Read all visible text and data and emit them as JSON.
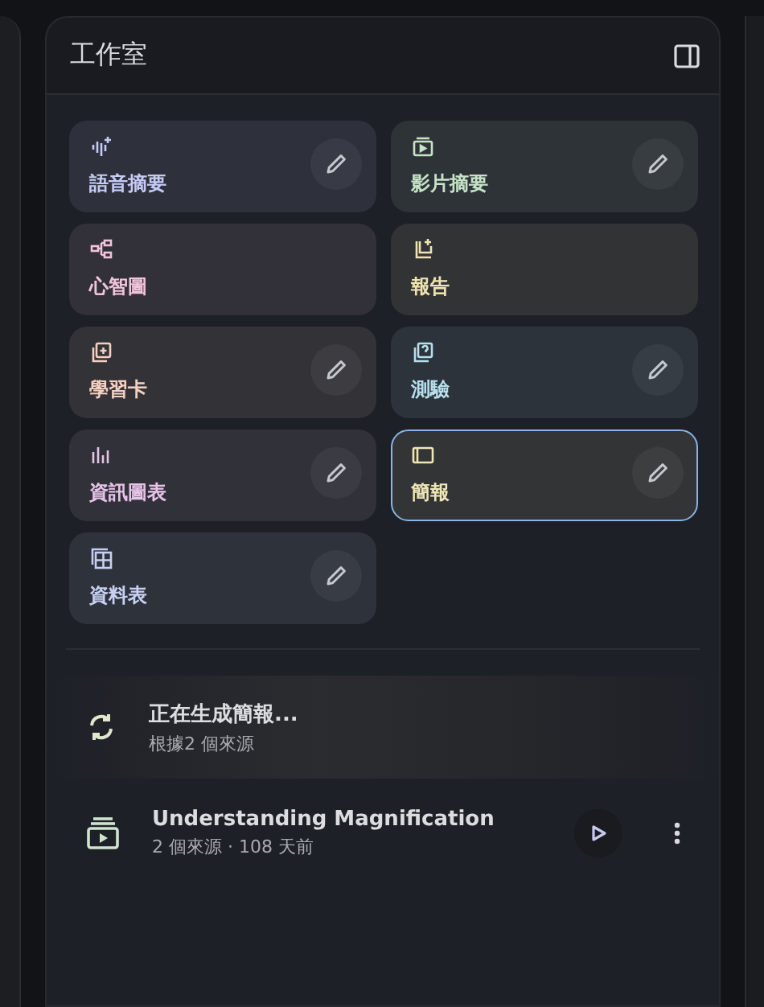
{
  "panel": {
    "title": "工作室"
  },
  "tiles": [
    {
      "label": "語音摘要",
      "kind": "audio",
      "color": "#c5cbf5",
      "editable": true,
      "selected": false
    },
    {
      "label": "影片摘要",
      "kind": "video",
      "color": "#c6e3c8",
      "editable": true,
      "selected": false
    },
    {
      "label": "心智圖",
      "kind": "mindmap",
      "color": "#f2c4dc",
      "editable": false,
      "selected": false
    },
    {
      "label": "報告",
      "kind": "report",
      "color": "#efe4b0",
      "editable": false,
      "selected": false
    },
    {
      "label": "學習卡",
      "kind": "flashcard",
      "color": "#f5cfc0",
      "editable": true,
      "selected": false
    },
    {
      "label": "測驗",
      "kind": "quiz",
      "color": "#b6dfec",
      "editable": true,
      "selected": false
    },
    {
      "label": "資訊圖表",
      "kind": "infographic",
      "color": "#e6c4e8",
      "editable": true,
      "selected": false
    },
    {
      "label": "簡報",
      "kind": "slides",
      "color": "#eee6b6",
      "editable": true,
      "selected": true
    },
    {
      "label": "資料表",
      "kind": "table",
      "color": "#c8d0f2",
      "editable": true,
      "selected": false
    }
  ],
  "outputs": [
    {
      "kind": "generating",
      "title": "正在生成簡報...",
      "meta": "根據2 個來源"
    },
    {
      "kind": "video",
      "title": "Understanding Magnification",
      "meta": "2 個來源 · 108 天前"
    }
  ]
}
